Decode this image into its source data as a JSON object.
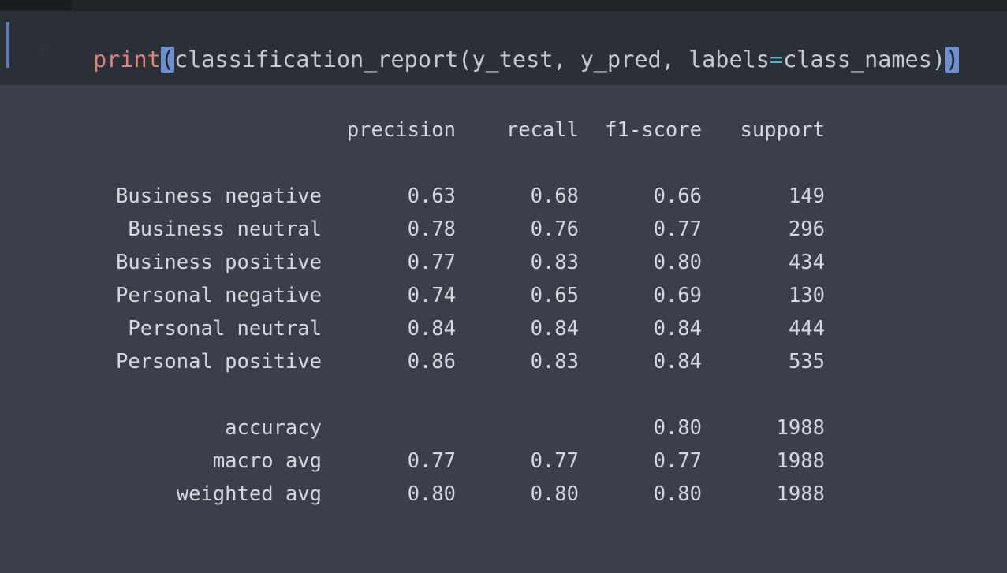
{
  "code": {
    "fn": "print",
    "open_paren": "(",
    "call": "classification_report(y_test, y_pred, labels",
    "op": "=",
    "arg": "class_names)",
    "close_paren": ")"
  },
  "report": {
    "headers": {
      "precision": "precision",
      "recall": "recall",
      "f1": "f1-score",
      "support": "support"
    },
    "rows": [
      {
        "label": "Business negative",
        "precision": "0.63",
        "recall": "0.68",
        "f1": "0.66",
        "support": "149"
      },
      {
        "label": "Business neutral",
        "precision": "0.78",
        "recall": "0.76",
        "f1": "0.77",
        "support": "296"
      },
      {
        "label": "Business positive",
        "precision": "0.77",
        "recall": "0.83",
        "f1": "0.80",
        "support": "434"
      },
      {
        "label": "Personal negative",
        "precision": "0.74",
        "recall": "0.65",
        "f1": "0.69",
        "support": "130"
      },
      {
        "label": "Personal neutral",
        "precision": "0.84",
        "recall": "0.84",
        "f1": "0.84",
        "support": "444"
      },
      {
        "label": "Personal positive",
        "precision": "0.86",
        "recall": "0.83",
        "f1": "0.84",
        "support": "535"
      }
    ],
    "summary": [
      {
        "label": "accuracy",
        "precision": "",
        "recall": "",
        "f1": "0.80",
        "support": "1988"
      },
      {
        "label": "macro avg",
        "precision": "0.77",
        "recall": "0.77",
        "f1": "0.77",
        "support": "1988"
      },
      {
        "label": "weighted avg",
        "precision": "0.80",
        "recall": "0.80",
        "f1": "0.80",
        "support": "1988"
      }
    ]
  }
}
